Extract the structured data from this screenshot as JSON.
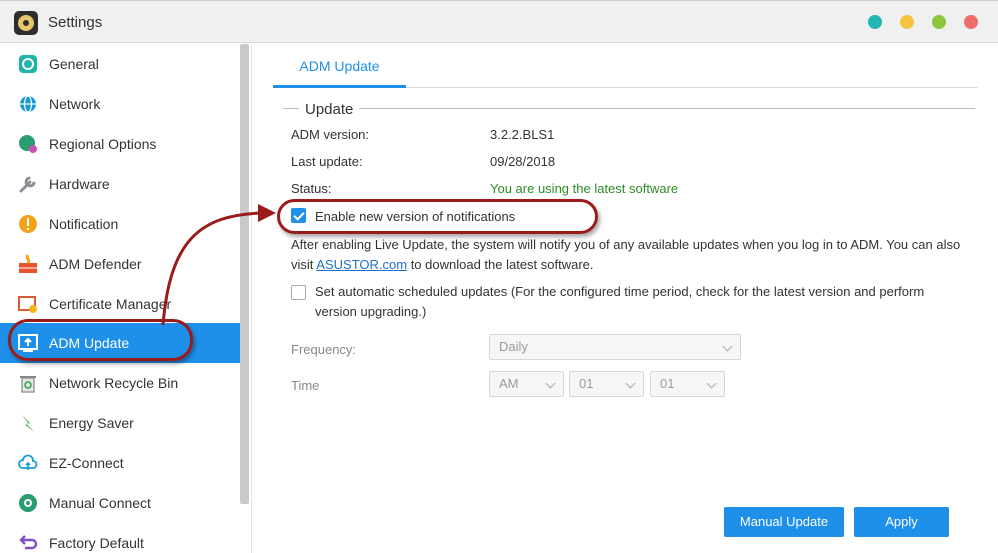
{
  "window": {
    "title": "Settings"
  },
  "window_controls": [
    {
      "name": "minimize-dot",
      "color": "#24b5b5"
    },
    {
      "name": "restore-dot",
      "color": "#f5c341"
    },
    {
      "name": "maximize-dot",
      "color": "#8cc63f"
    },
    {
      "name": "close-dot",
      "color": "#f06b6b"
    }
  ],
  "sidebar": {
    "items": [
      {
        "label": "General",
        "icon": "general-icon"
      },
      {
        "label": "Network",
        "icon": "globe-icon"
      },
      {
        "label": "Regional Options",
        "icon": "regional-globe-icon"
      },
      {
        "label": "Hardware",
        "icon": "wrench-icon"
      },
      {
        "label": "Notification",
        "icon": "alert-icon"
      },
      {
        "label": "ADM Defender",
        "icon": "firewall-icon"
      },
      {
        "label": "Certificate Manager",
        "icon": "certificate-icon"
      },
      {
        "label": "ADM Update",
        "icon": "update-icon",
        "active": true
      },
      {
        "label": "Network Recycle Bin",
        "icon": "recycle-bin-icon"
      },
      {
        "label": "Energy Saver",
        "icon": "lightning-icon"
      },
      {
        "label": "EZ-Connect",
        "icon": "cloud-icon"
      },
      {
        "label": "Manual Connect",
        "icon": "manual-connect-icon"
      },
      {
        "label": "Factory Default",
        "icon": "reset-icon"
      }
    ]
  },
  "tabs": [
    {
      "label": "ADM Update",
      "active": true
    }
  ],
  "update": {
    "section_title": "Update",
    "adm_version_label": "ADM version:",
    "adm_version_value": "3.2.2.BLS1",
    "last_update_label": "Last update:",
    "last_update_value": "09/28/2018",
    "status_label": "Status:",
    "status_value": "You are using the latest software",
    "status_color": "#2e8b28",
    "enable_notifications_label": "Enable new version of notifications",
    "enable_notifications_checked": true,
    "info_text_1": "After enabling Live Update, the system will notify you of any available updates when you log in to ADM. You can also",
    "info_text_2_prefix": "visit ",
    "info_link": "ASUSTOR.com",
    "info_text_2_suffix": " to download the latest software.",
    "auto_update_label_line1": "Set automatic scheduled updates (For the configured time period, check for the latest version and perform",
    "auto_update_label_line2": "version upgrading.)",
    "auto_update_checked": false,
    "frequency_label": "Frequency:",
    "frequency_value": "Daily",
    "time_label": "Time",
    "time_ampm": "AM",
    "time_hour": "01",
    "time_minute": "01"
  },
  "buttons": {
    "manual_update": "Manual Update",
    "apply": "Apply"
  },
  "accent_color": "#1e90ea",
  "annotation_color": "#9b1b1b"
}
